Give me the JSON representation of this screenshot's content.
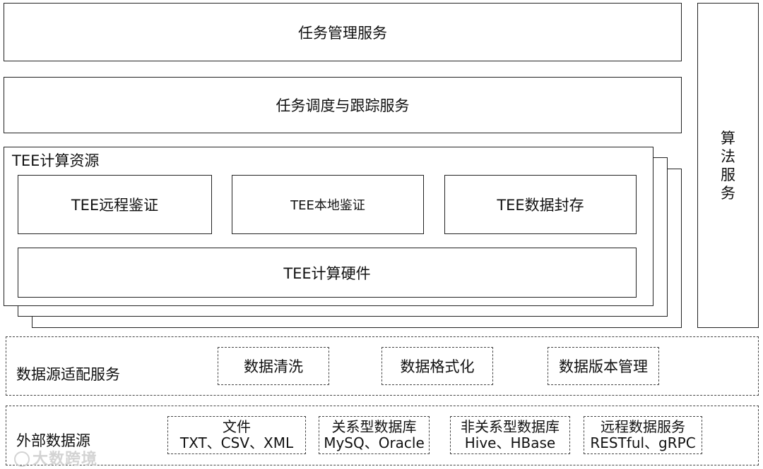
{
  "task_management": "任务管理服务",
  "task_scheduling": "任务调度与跟踪服务",
  "algorithm_service": [
    "算",
    "法",
    "服",
    "务"
  ],
  "tee": {
    "title": "TEE计算资源",
    "remote_attestation": "TEE远程鉴证",
    "local_attestation": "TEE本地鉴证",
    "data_sealing": "TEE数据封存",
    "hardware": "TEE计算硬件"
  },
  "adapter": {
    "title": "数据源适配服务",
    "items": [
      "数据清洗",
      "数据格式化",
      "数据版本管理"
    ]
  },
  "external": {
    "title": "外部数据源",
    "items": [
      {
        "line1": "文件",
        "line2": "TXT、CSV、XML"
      },
      {
        "line1": "关系型数据库",
        "line2": "MySQ、Oracle"
      },
      {
        "line1": "非关系型数据库",
        "line2": "Hive、HBase"
      },
      {
        "line1": "远程数据服务",
        "line2": "RESTful、gRPC"
      }
    ]
  },
  "watermark": "大数跨境"
}
